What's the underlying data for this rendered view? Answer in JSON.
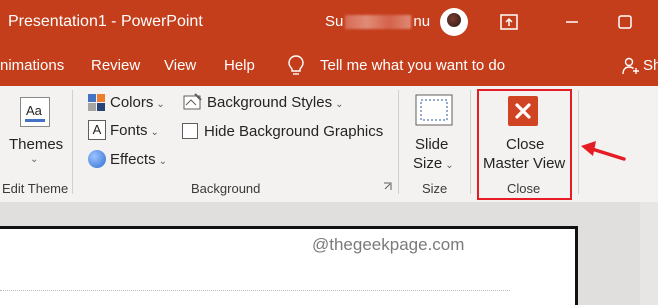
{
  "window": {
    "title": "Presentation1  -  PowerPoint",
    "user_name_start": "Su",
    "user_name_end": "nu"
  },
  "menu": {
    "tabs": [
      "nimations",
      "Review",
      "View",
      "Help"
    ],
    "tell_me": "Tell me what you want to do",
    "share_partial": "Sh"
  },
  "ribbon": {
    "edit_theme": {
      "themes_label": "Themes",
      "themes_icon_text": "Aa",
      "group_label": "Edit Theme"
    },
    "background": {
      "colors_label": "Colors",
      "fonts_label": "Fonts",
      "effects_label": "Effects",
      "background_styles_label": "Background Styles",
      "hide_background_label": "Hide Background Graphics",
      "hide_background_checked": false,
      "group_label": "Background"
    },
    "size": {
      "slide_size_line1": "Slide",
      "slide_size_line2": "Size",
      "group_label": "Size"
    },
    "close": {
      "close_line1": "Close",
      "close_line2": "Master View",
      "group_label": "Close"
    }
  },
  "watermark": "@thegeekpage.com",
  "colors": {
    "accent": "#c43e1c",
    "highlight": "#e51c23",
    "close_icon": "#d04423"
  }
}
